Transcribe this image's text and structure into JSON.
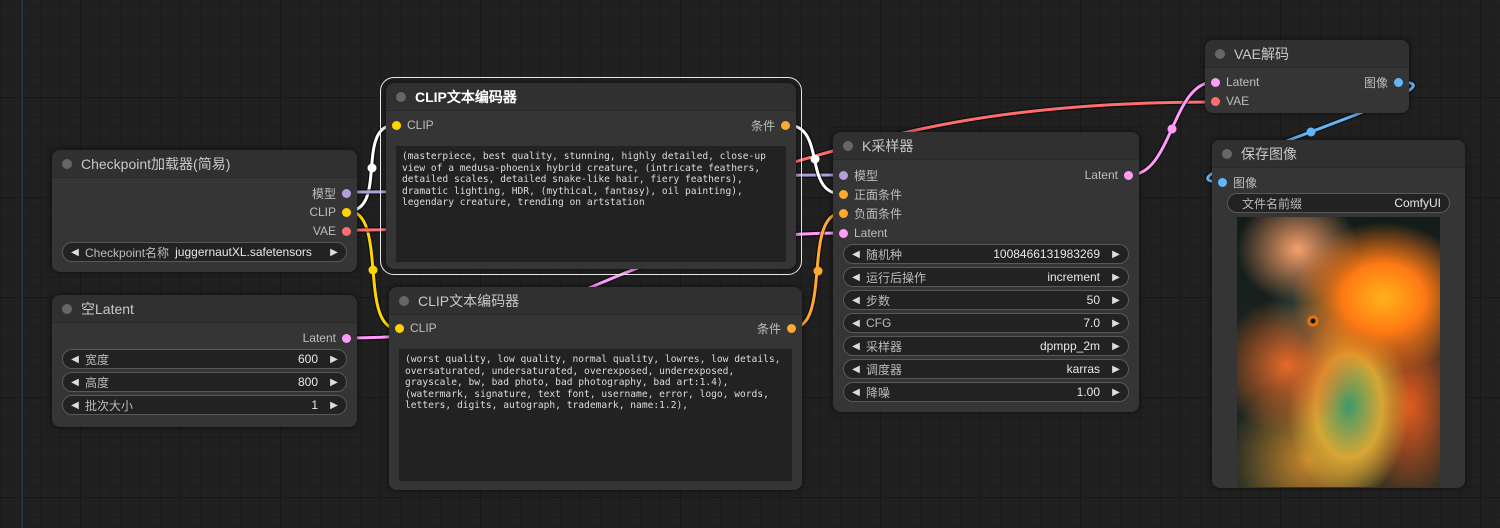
{
  "colors": {
    "model": "#b39ddb",
    "clip": "#ffd500",
    "vae": "#ff6e6e",
    "latent": "#ff9cf9",
    "conditioning": "#ffa931",
    "image": "#64b5f6",
    "link_white": "#ffffff"
  },
  "nodes": {
    "checkpoint_loader": {
      "title": "Checkpoint加载器(简易)",
      "outputs": [
        "模型",
        "CLIP",
        "VAE"
      ],
      "widgets": [
        {
          "label": "Checkpoint名称",
          "value": "juggernautXL.safetensors"
        }
      ]
    },
    "empty_latent": {
      "title": "空Latent",
      "outputs": [
        "Latent"
      ],
      "widgets": [
        {
          "label": "宽度",
          "value": "600"
        },
        {
          "label": "高度",
          "value": "800"
        },
        {
          "label": "批次大小",
          "value": "1"
        }
      ]
    },
    "clip_positive": {
      "title": "CLIP文本编码器",
      "input": "CLIP",
      "output": "条件",
      "text": "(masterpiece, best quality, stunning, highly detailed, close-up view of a medusa-phoenix hybrid creature, (intricate feathers, detailed scales, detailed snake-like hair, fiery feathers), dramatic lighting, HDR, (mythical, fantasy), oil painting), legendary creature, trending on artstation"
    },
    "clip_negative": {
      "title": "CLIP文本编码器",
      "input": "CLIP",
      "output": "条件",
      "text": "(worst quality, low quality, normal quality, lowres, low details, oversaturated, undersaturated, overexposed, underexposed, grayscale, bw, bad photo, bad photography, bad art:1.4), (watermark, signature, text font, username, error, logo, words, letters, digits, autograph, trademark, name:1.2),"
    },
    "ksampler": {
      "title": "K采样器",
      "inputs": [
        "模型",
        "正面条件",
        "负面条件",
        "Latent"
      ],
      "output": "Latent",
      "widgets": [
        {
          "label": "随机种",
          "value": "1008466131983269"
        },
        {
          "label": "运行后操作",
          "value": "increment"
        },
        {
          "label": "步数",
          "value": "50"
        },
        {
          "label": "CFG",
          "value": "7.0"
        },
        {
          "label": "采样器",
          "value": "dpmpp_2m"
        },
        {
          "label": "调度器",
          "value": "karras"
        },
        {
          "label": "降噪",
          "value": "1.00"
        }
      ]
    },
    "vae_decode": {
      "title": "VAE解码",
      "inputs": [
        "Latent",
        "VAE"
      ],
      "output": "图像"
    },
    "save_image": {
      "title": "保存图像",
      "input": "图像",
      "widgets": [
        {
          "label": "文件名前缀",
          "value": "ComfyUI"
        }
      ],
      "preview_description": "medusa-phoenix hybrid creature artwork"
    }
  }
}
